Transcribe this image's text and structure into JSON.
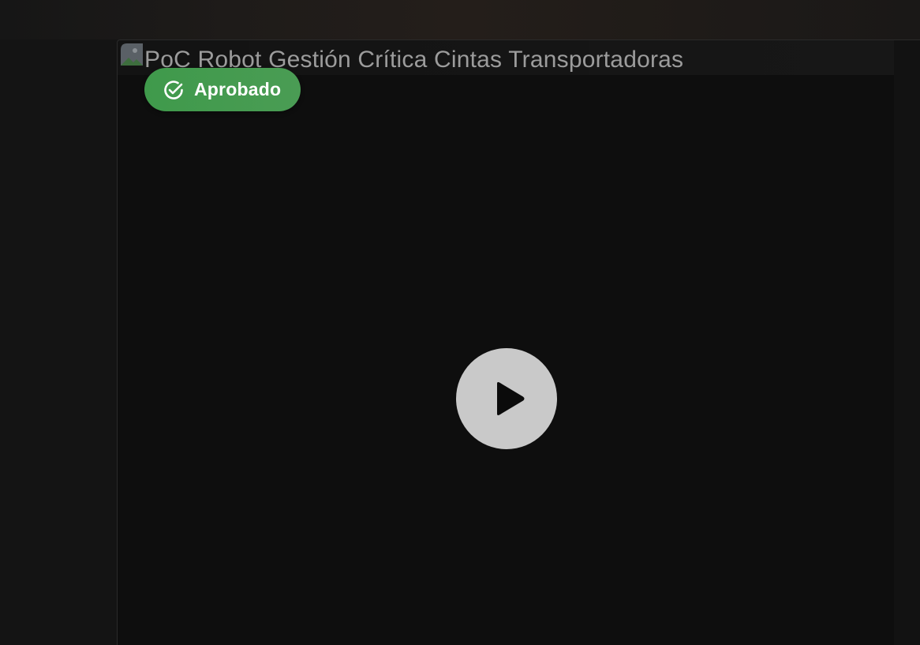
{
  "video": {
    "title": "PoC Robot Gestión Crítica Cintas Transportadoras",
    "status": {
      "label": "Aprobado",
      "icon": "check-circle-icon",
      "color": "#459b50"
    },
    "play_icon": "play-icon"
  },
  "colors": {
    "background": "#141414",
    "video_background": "#0e0e0e",
    "play_button": "#c9c9c9"
  }
}
